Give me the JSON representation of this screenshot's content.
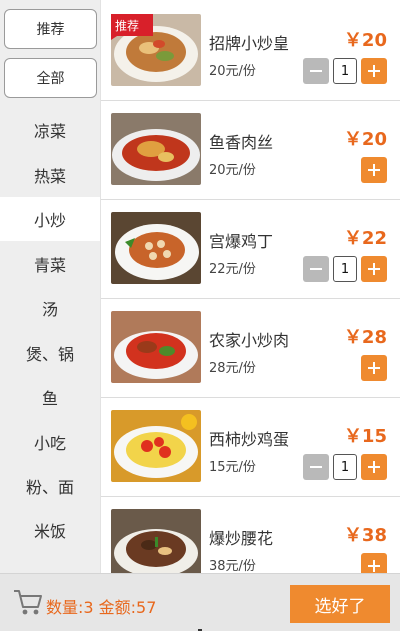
{
  "sidebar": {
    "buttons": [
      {
        "label": "推荐"
      },
      {
        "label": "全部"
      }
    ],
    "categories": [
      {
        "label": "凉菜"
      },
      {
        "label": "热菜"
      },
      {
        "label": "小炒",
        "active": true
      },
      {
        "label": "青菜"
      },
      {
        "label": "汤"
      },
      {
        "label": "煲、锅"
      },
      {
        "label": "鱼"
      },
      {
        "label": "小吃"
      },
      {
        "label": "粉、面"
      },
      {
        "label": "米饭"
      }
    ]
  },
  "items": [
    {
      "name": "招牌小炒皇",
      "unit": "20元/份",
      "price": "￥20",
      "qty": "1",
      "badge": "推荐",
      "icon": "stir-fry-image"
    },
    {
      "name": "鱼香肉丝",
      "unit": "20元/份",
      "price": "￥20",
      "icon": "shredded-pork-image"
    },
    {
      "name": "宫爆鸡丁",
      "unit": "22元/份",
      "price": "￥22",
      "qty": "1",
      "icon": "kung-pao-chicken-image"
    },
    {
      "name": "农家小炒肉",
      "unit": "28元/份",
      "price": "￥28",
      "icon": "farm-pork-image"
    },
    {
      "name": "西柿炒鸡蛋",
      "unit": "15元/份",
      "price": "￥15",
      "qty": "1",
      "icon": "tomato-egg-image"
    },
    {
      "name": "爆炒腰花",
      "unit": "38元/份",
      "price": "￥38",
      "icon": "kidney-image"
    }
  ],
  "footer": {
    "summary": "数量:3 金额:57",
    "submit_label": "选好了",
    "cart_icon": "shopping-cart-icon"
  },
  "colors": {
    "accent": "#ef8a2f",
    "price": "#e8681d",
    "badge": "#d8202a"
  }
}
